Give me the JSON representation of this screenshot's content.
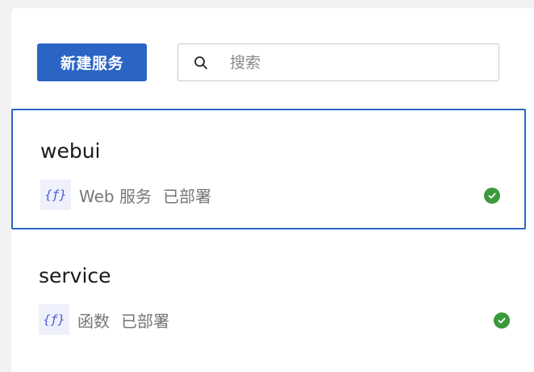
{
  "toolbar": {
    "new_service_label": "新建服务",
    "search_placeholder": "搜索"
  },
  "services": [
    {
      "name": "webui",
      "type_label": "Web 服务",
      "status_label": "已部署",
      "icon": "function-icon",
      "status_icon": "check-circle-icon",
      "selected": true
    },
    {
      "name": "service",
      "type_label": "函数",
      "status_label": "已部署",
      "icon": "function-icon",
      "status_icon": "check-circle-icon",
      "selected": false
    }
  ],
  "colors": {
    "accent": "#2a64c5",
    "success": "#3a9a3c",
    "icon_bg": "#eef0fb",
    "icon_fg": "#4a5bd4"
  }
}
